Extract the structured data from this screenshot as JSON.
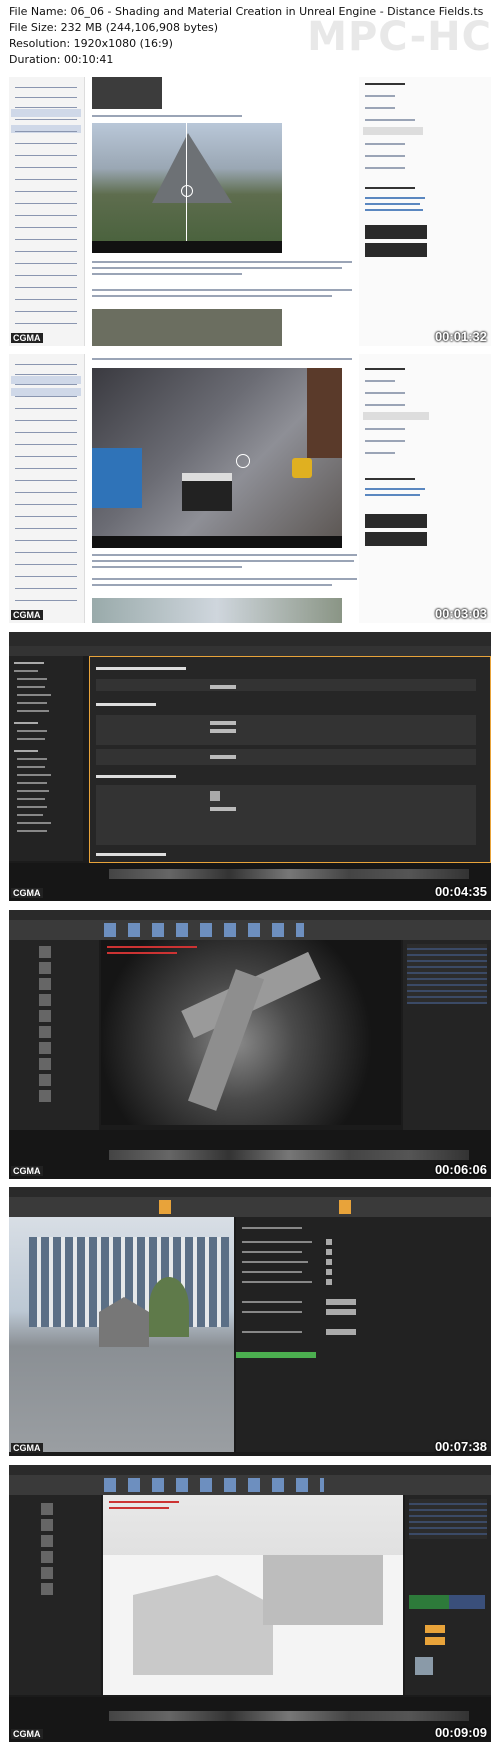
{
  "info": {
    "file_name": "File Name: 06_06 - Shading and Material Creation in Unreal Engine - Distance Fields.ts",
    "file_size": "File Size: 232 MB (244,106,908 bytes)",
    "resolution": "Resolution: 1920x1080 (16:9)",
    "duration": "Duration: 00:10:41"
  },
  "player": {
    "name": "MPC-HC"
  },
  "frames": [
    {
      "timestamp": "00:01:32",
      "brand": "CGMA"
    },
    {
      "timestamp": "00:03:03",
      "brand": "CGMA"
    },
    {
      "timestamp": "00:04:35",
      "brand": "CGMA"
    },
    {
      "timestamp": "00:06:06",
      "brand": "CGMA"
    },
    {
      "timestamp": "00:07:38",
      "brand": "CGMA"
    },
    {
      "timestamp": "00:09:09",
      "brand": "CGMA"
    }
  ],
  "colors": {
    "editor_bg": "#1b1b1b",
    "docs_bg": "#ffffff",
    "accent_orange": "#e8a33a",
    "accent_green": "#4caf50"
  }
}
